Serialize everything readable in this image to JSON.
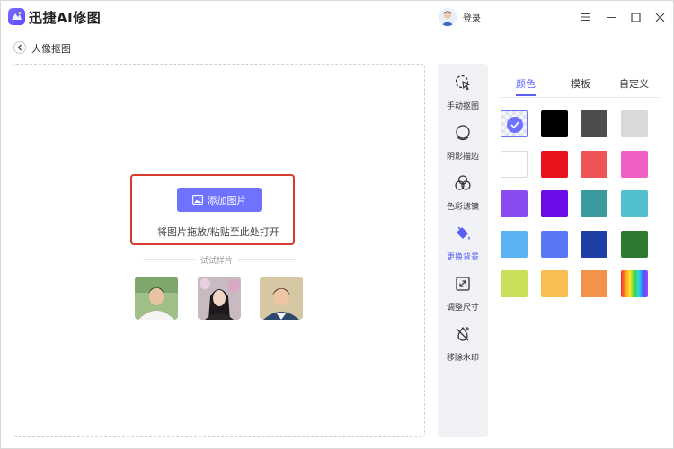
{
  "app": {
    "title": "迅捷AI修图",
    "login": "登录"
  },
  "breadcrumb": {
    "title": "人像抠图"
  },
  "upload": {
    "add_button": "添加图片",
    "hint": "将图片拖放/粘贴至此处打开",
    "samples_label": "试试样片"
  },
  "tools": [
    {
      "label": "手动抠图",
      "icon": "cursor-select-icon"
    },
    {
      "label": "阴影描边",
      "icon": "shadow-outline-icon"
    },
    {
      "label": "色彩滤镜",
      "icon": "color-filter-icon"
    },
    {
      "label": "更换背景",
      "icon": "paint-bucket-icon",
      "active": true
    },
    {
      "label": "调整尺寸",
      "icon": "resize-icon"
    },
    {
      "label": "移除水印",
      "icon": "remove-watermark-icon"
    }
  ],
  "panel": {
    "tabs": [
      "颜色",
      "模板",
      "自定义"
    ],
    "active_tab": "颜色",
    "colors": [
      "transparent",
      "#000000",
      "#4d4d4d",
      "#d9d9d9",
      "#ffffff",
      "#e8131c",
      "#ee5356",
      "#f060c4",
      "#8a4bf0",
      "#6a0de6",
      "#3a9a9e",
      "#4fc0cc",
      "#5cb1f2",
      "#5a77f5",
      "#1f3fa6",
      "#2e7a31",
      "#cbe05a",
      "#f8be53",
      "#f3924a",
      "rainbow"
    ],
    "selected_color_index": 0
  }
}
